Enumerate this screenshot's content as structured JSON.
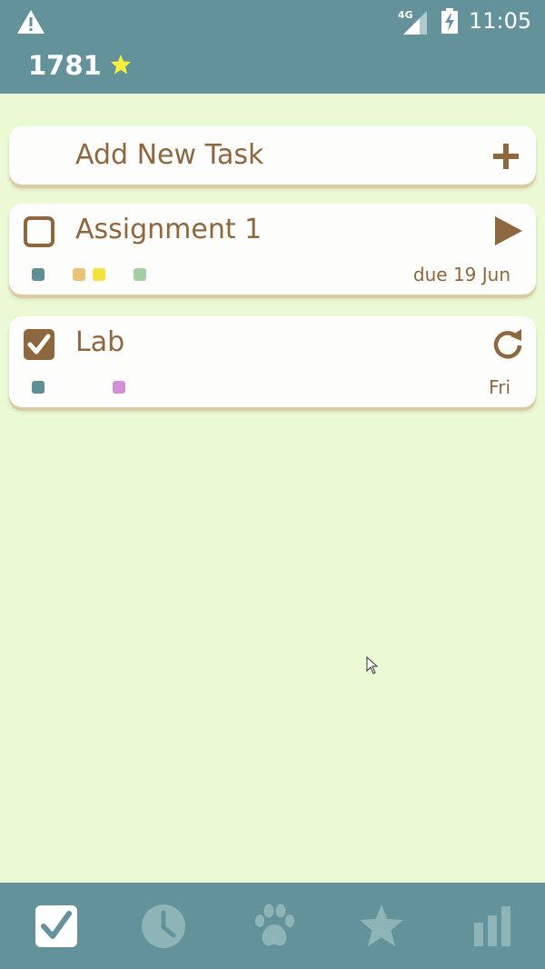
{
  "status_bar": {
    "network_label": "4G",
    "time": "11:05",
    "icons": [
      "warning-icon",
      "signal-icon",
      "battery-charging-icon"
    ]
  },
  "header": {
    "score": "1781",
    "score_icon": "star-icon"
  },
  "add_task": {
    "label": "Add New Task",
    "icon": "plus-icon"
  },
  "tasks": [
    {
      "title": "Assignment 1",
      "checked": false,
      "action_icon": "play-icon",
      "due": "due 19 Jun",
      "tag_colors": [
        "#5e8f96",
        "#e9c27c",
        "#f5e13c",
        "#a4cfa2"
      ]
    },
    {
      "title": "Lab",
      "checked": true,
      "action_icon": "repeat-icon",
      "due": "Fri",
      "tag_colors": [
        "#5e8f96",
        "#d48fd6"
      ]
    }
  ],
  "bottom_nav": [
    {
      "icon": "tasks-checkbox-icon",
      "active": true
    },
    {
      "icon": "clock-icon",
      "active": false
    },
    {
      "icon": "paw-icon",
      "active": false
    },
    {
      "icon": "star-icon",
      "active": false
    },
    {
      "icon": "stats-icon",
      "active": false
    }
  ],
  "colors": {
    "primary": "#63929a",
    "background": "#ebf9d4",
    "card": "#fdfdfc",
    "accent_brown": "#8e673f",
    "star_yellow": "#f8ef3e",
    "nav_inactive": "#8fb4b8"
  }
}
